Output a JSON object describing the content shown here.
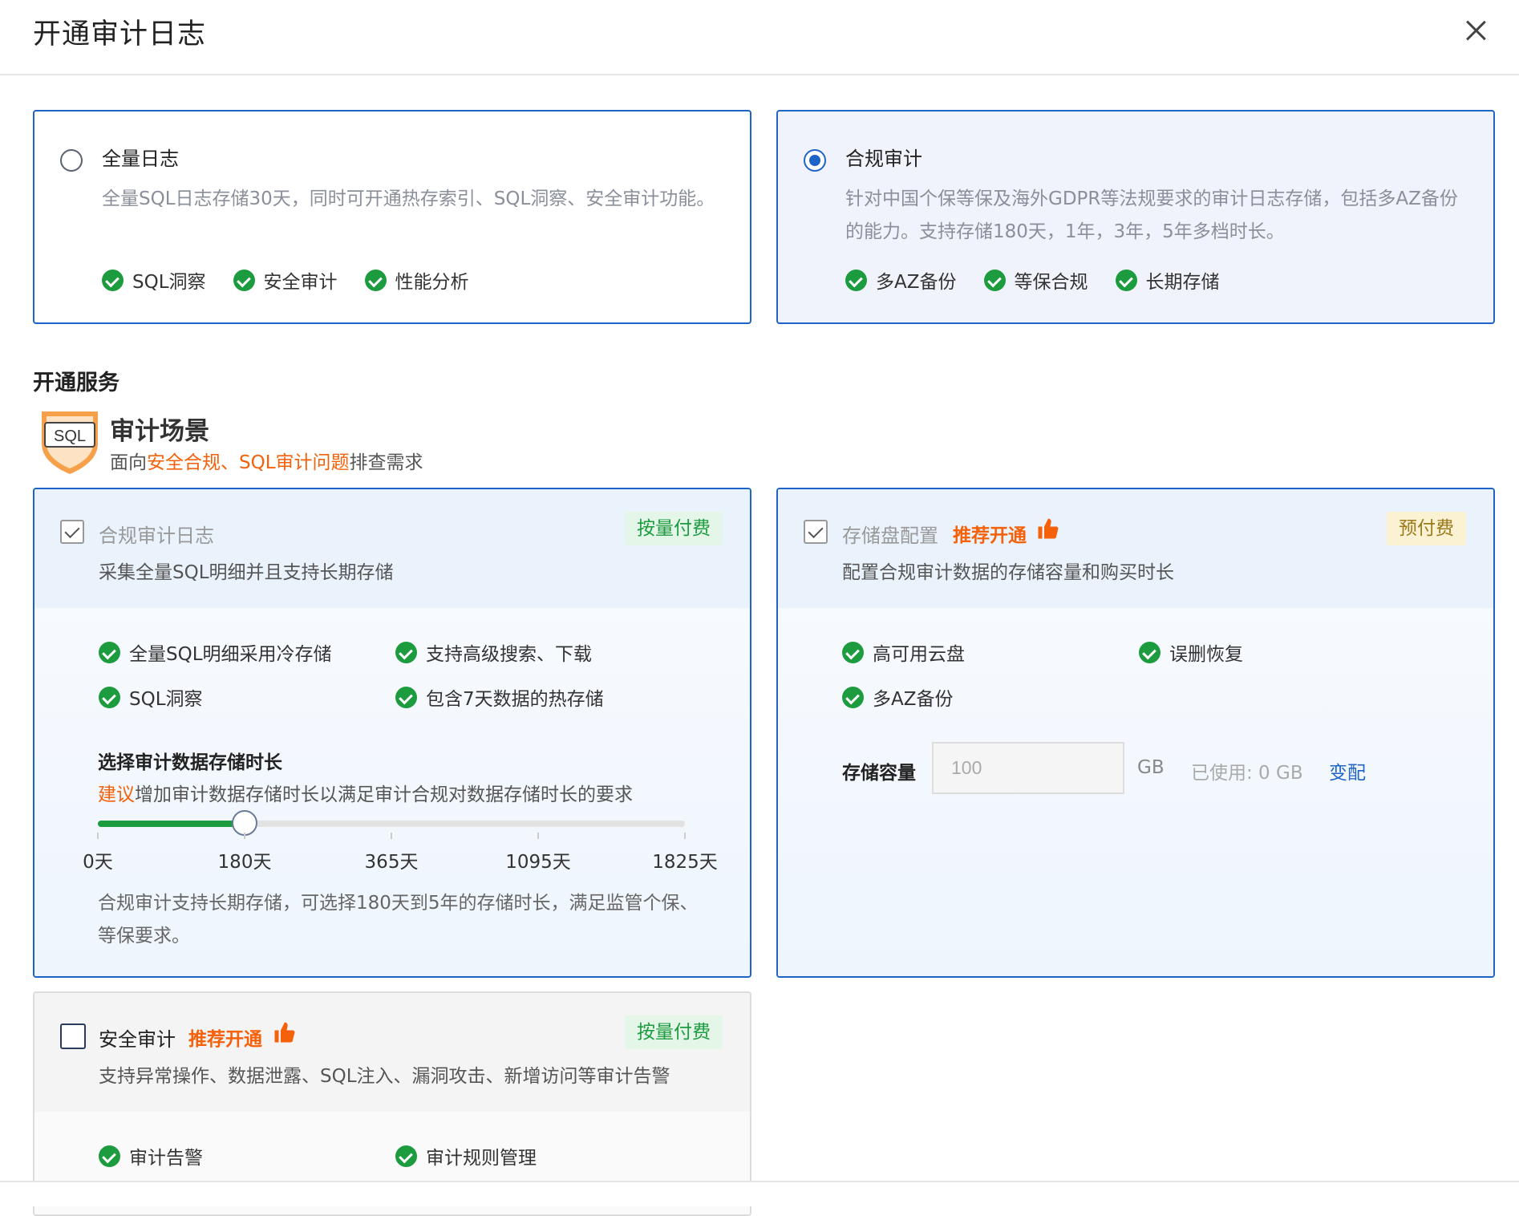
{
  "dialog": {
    "title": "开通审计日志"
  },
  "options": [
    {
      "title": "全量日志",
      "desc": "全量SQL日志存储30天，同时可开通热存索引、SQL洞察、安全审计功能。",
      "tags": [
        "SQL洞察",
        "安全审计",
        "性能分析"
      ],
      "selected": false
    },
    {
      "title": "合规审计",
      "desc": "针对中国个保等保及海外GDPR等法规要求的审计日志存储，包括多AZ备份的能力。支持存储180天，1年，3年，5年多档时长。",
      "tags": [
        "多AZ备份",
        "等保合规",
        "长期存储"
      ],
      "selected": true
    }
  ],
  "service": {
    "section_title": "开通服务",
    "scene_title": "审计场景",
    "icon_text": "SQL",
    "scene_sub_a": "面向",
    "scene_sub_hl": "安全合规、SQL审计问题",
    "scene_sub_b": "排查需求"
  },
  "log_card": {
    "title": "合规审计日志",
    "sub": "采集全量SQL明细并且支持长期存储",
    "pill": "按量付费",
    "features": [
      "全量SQL明细采用冷存储",
      "支持高级搜索、下载",
      "SQL洞察",
      "包含7天数据的热存储"
    ],
    "duration_title": "选择审计数据存储时长",
    "duration_hl": "建议",
    "duration_desc": "增加审计数据存储时长以满足审计合规对数据存储时长的要求",
    "slider_labels": [
      "0天",
      "180天",
      "365天",
      "1095天",
      "1825天"
    ],
    "slider_selected": "180天",
    "slider_fraction": 0.25,
    "note": "合规审计支持长期存储，可选择180天到5年的存储时长，满足监管个保、等保要求。"
  },
  "storage_card": {
    "title": "存储盘配置",
    "recommend": "推荐开通",
    "sub": "配置合规审计数据的存储容量和购买时长",
    "pill": "预付费",
    "features": [
      "高可用云盘",
      "误删恢复",
      "多AZ备份"
    ],
    "capacity_label": "存储容量",
    "capacity_placeholder": "100",
    "unit": "GB",
    "used": "已使用: 0 GB",
    "change_link": "变配"
  },
  "security_card": {
    "title": "安全审计",
    "recommend": "推荐开通",
    "sub": "支持异常操作、数据泄露、SQL注入、漏洞攻击、新增访问等审计告警",
    "pill": "按量付费",
    "features": [
      "审计告警",
      "审计规则管理"
    ]
  },
  "colors": {
    "primary": "#1e64c8",
    "success": "#1d9b3f",
    "accent": "#f5610a"
  }
}
